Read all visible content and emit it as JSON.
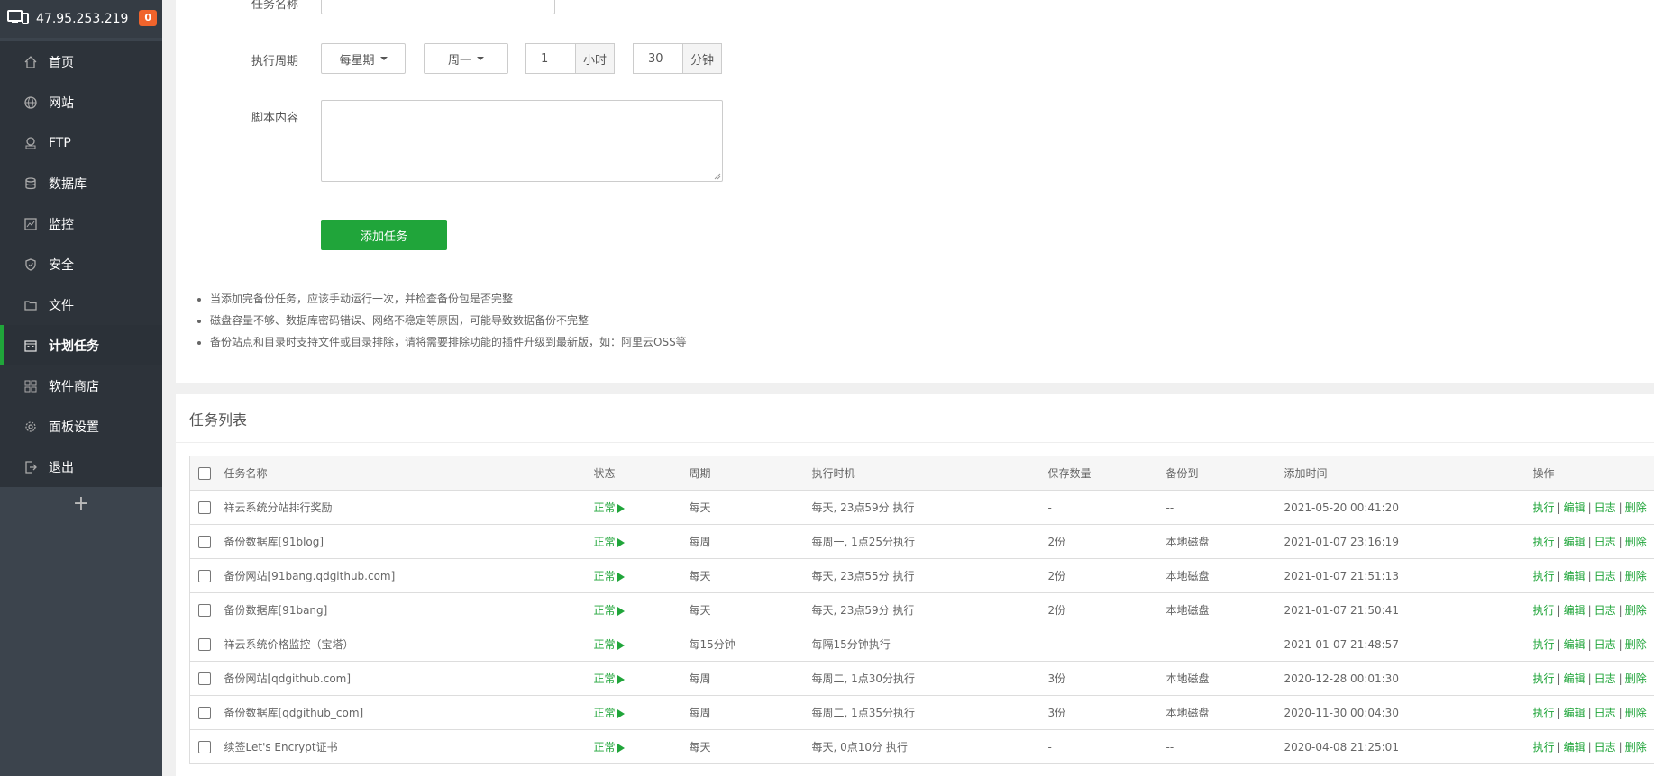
{
  "server": {
    "ip": "47.95.253.219",
    "badge_count": "0"
  },
  "sidebar": {
    "items": [
      {
        "label": "首页",
        "icon": "home-icon",
        "active": false
      },
      {
        "label": "网站",
        "icon": "globe-icon",
        "active": false
      },
      {
        "label": "FTP",
        "icon": "ftp-icon",
        "active": false
      },
      {
        "label": "数据库",
        "icon": "database-icon",
        "active": false
      },
      {
        "label": "监控",
        "icon": "monitor-icon",
        "active": false
      },
      {
        "label": "安全",
        "icon": "shield-icon",
        "active": false
      },
      {
        "label": "文件",
        "icon": "folder-icon",
        "active": false
      },
      {
        "label": "计划任务",
        "icon": "calendar-icon",
        "active": true
      },
      {
        "label": "软件商店",
        "icon": "apps-icon",
        "active": false
      },
      {
        "label": "面板设置",
        "icon": "gear-icon",
        "active": false
      },
      {
        "label": "退出",
        "icon": "logout-icon",
        "active": false
      }
    ],
    "add_label": "+"
  },
  "form": {
    "task_name_label": "任务名称",
    "period_label": "执行周期",
    "period_type": "每星期",
    "weekday": "周一",
    "hour_value": "1",
    "hour_unit": "小时",
    "minute_value": "30",
    "minute_unit": "分钟",
    "script_label": "脚本内容",
    "add_button": "添加任务",
    "tips": [
      "当添加完备份任务，应该手动运行一次，并检查备份包是否完整",
      "磁盘容量不够、数据库密码错误、网络不稳定等原因，可能导致数据备份不完整",
      "备份站点和目录时支持文件或目录排除，请将需要排除功能的插件升级到最新版，如：阿里云OSS等"
    ]
  },
  "task_list": {
    "title": "任务列表",
    "columns": [
      "任务名称",
      "状态",
      "周期",
      "执行时机",
      "保存数量",
      "备份到",
      "添加时间",
      "操作"
    ],
    "rows": [
      {
        "name": "祥云系统分站排行奖励",
        "status": "正常",
        "period": "每天",
        "timing": "每天, 23点59分 执行",
        "keep": "-",
        "backup_to": "--",
        "added": "2021-05-20 00:41:20"
      },
      {
        "name": "备份数据库[91blog]",
        "status": "正常",
        "period": "每周",
        "timing": "每周一, 1点25分执行",
        "keep": "2份",
        "backup_to": "本地磁盘",
        "added": "2021-01-07 23:16:19"
      },
      {
        "name": "备份网站[91bang.qdgithub.com]",
        "status": "正常",
        "period": "每天",
        "timing": "每天, 23点55分 执行",
        "keep": "2份",
        "backup_to": "本地磁盘",
        "added": "2021-01-07 21:51:13"
      },
      {
        "name": "备份数据库[91bang]",
        "status": "正常",
        "period": "每天",
        "timing": "每天, 23点59分 执行",
        "keep": "2份",
        "backup_to": "本地磁盘",
        "added": "2021-01-07 21:50:41"
      },
      {
        "name": "祥云系统价格监控（宝塔）",
        "status": "正常",
        "period": "每15分钟",
        "timing": "每隔15分钟执行",
        "keep": "-",
        "backup_to": "--",
        "added": "2021-01-07 21:48:57"
      },
      {
        "name": "备份网站[qdgithub.com]",
        "status": "正常",
        "period": "每周",
        "timing": "每周二, 1点30分执行",
        "keep": "3份",
        "backup_to": "本地磁盘",
        "added": "2020-12-28 00:01:30"
      },
      {
        "name": "备份数据库[qdgithub_com]",
        "status": "正常",
        "period": "每周",
        "timing": "每周二, 1点35分执行",
        "keep": "3份",
        "backup_to": "本地磁盘",
        "added": "2020-11-30 00:04:30"
      },
      {
        "name": "续签Let's Encrypt证书",
        "status": "正常",
        "period": "每天",
        "timing": "每天, 0点10分 执行",
        "keep": "-",
        "backup_to": "--",
        "added": "2020-04-08 21:25:01"
      }
    ],
    "actions": [
      "执行",
      "编辑",
      "日志",
      "删除"
    ]
  },
  "colors": {
    "accent": "#20a53a",
    "sidebar_bg": "#3c444d",
    "badge": "#f0642c"
  }
}
